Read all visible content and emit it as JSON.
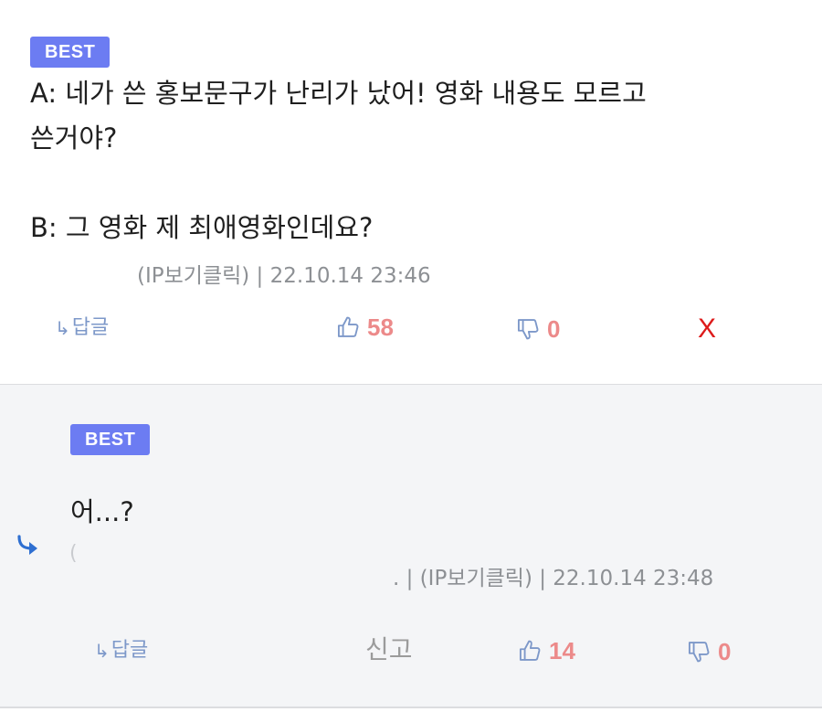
{
  "comment1": {
    "badge": "BEST",
    "lines": [
      "A: 네가 쓴 홍보문구가 난리가 났어! 영화 내용도 모르고",
      "쓴거야?",
      "B: 그 영화 제 최애영화인데요?"
    ],
    "meta": "(IP보기클릭) | 22.10.14 23:46",
    "reply_label": "답글",
    "upvotes": "58",
    "downvotes": "0",
    "delete_label": "X"
  },
  "comment2": {
    "badge": "BEST",
    "text": "어...?",
    "meta": ". | (IP보기클릭) | 22.10.14 23:48",
    "reply_label": "답글",
    "report_label": "신고",
    "upvotes": "14",
    "downvotes": "0"
  },
  "icons": {
    "reply": "reply-arrow-icon",
    "thumbs_up": "thumbs-up-icon",
    "thumbs_down": "thumbs-down-icon",
    "nested_reply": "nested-reply-icon"
  },
  "colors": {
    "badge": "#6c7cf2",
    "vote_count": "#ec8a8a",
    "icon_blue": "#7d98c9",
    "delete": "#dd1b1b",
    "reply_bg": "#f4f5f7"
  }
}
